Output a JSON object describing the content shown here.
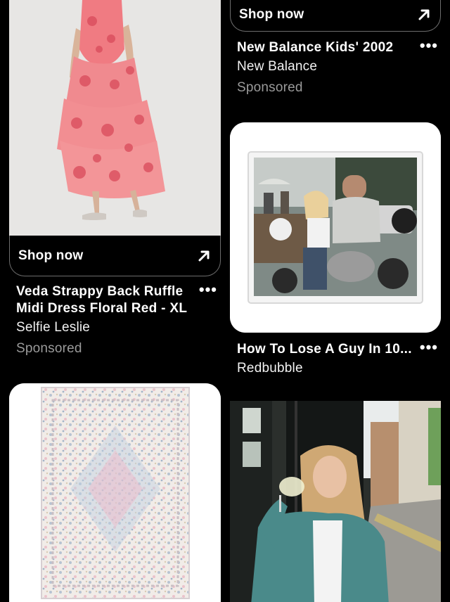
{
  "feed": {
    "pin_dress": {
      "shop_label": "Shop now",
      "title": "Veda Strappy Back Ruffle Midi Dress Floral Red - XL",
      "subtitle": "Selfie Leslie",
      "sponsored": "Sponsored"
    },
    "pin_shoes": {
      "shop_label": "Shop now",
      "title": "New Balance Kids' 2002",
      "subtitle": "New Balance",
      "sponsored": "Sponsored"
    },
    "pin_sticker": {
      "title": "How To Lose A Guy In 10...",
      "subtitle": "Redbubble"
    },
    "pin_rug": {},
    "pin_photo": {}
  },
  "icons": {
    "arrow": "arrow-up-right-icon",
    "more": "more-dots-icon"
  },
  "more_glyph": "•••",
  "colors": {
    "background": "#000000",
    "card": "#ffffff",
    "muted": "#9a9a9a",
    "border": "#6e6e6e"
  }
}
